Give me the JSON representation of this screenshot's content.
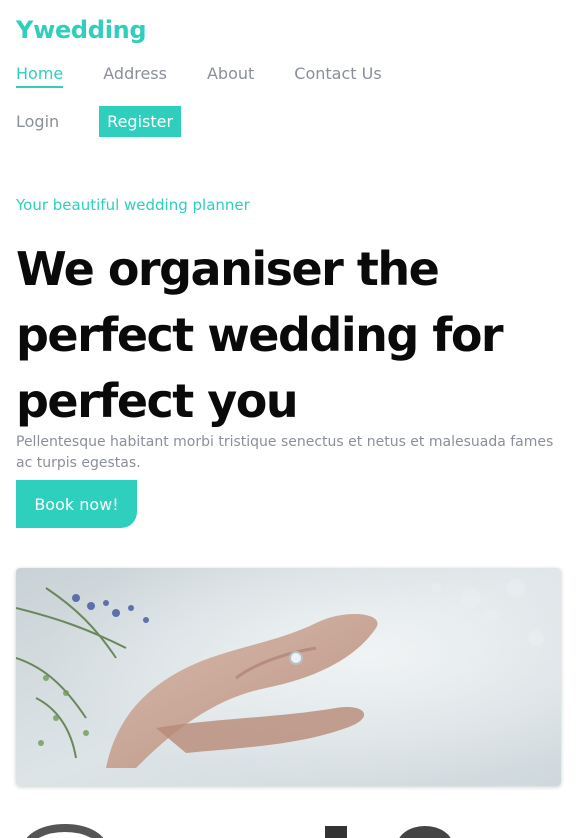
{
  "brand": {
    "name": "Ywedding",
    "accent_color": "#2ecfbd"
  },
  "nav": {
    "items": [
      {
        "label": "Home",
        "active": true
      },
      {
        "label": "Address",
        "active": false
      },
      {
        "label": "About",
        "active": false
      },
      {
        "label": "Contact Us",
        "active": false
      }
    ]
  },
  "auth": {
    "login_label": "Login",
    "register_label": "Register"
  },
  "hero": {
    "tagline": "Your beautiful wedding planner",
    "headline": "We organiser the perfect wedding for perfect you",
    "description": "Pellentesque habitant morbi tristique senectus et netus et malesuada fames ac turpis egestas.",
    "cta_label": "Book now!"
  }
}
